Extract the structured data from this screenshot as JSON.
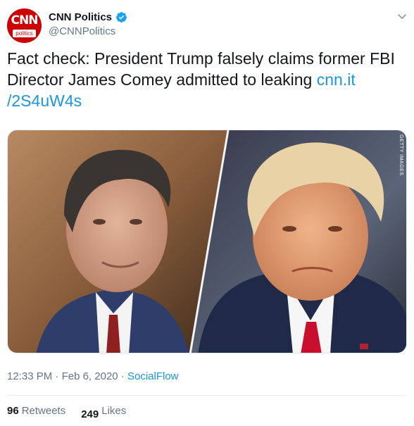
{
  "author": {
    "avatar_text": "CNN",
    "avatar_subtext": "politics",
    "display_name": "CNN Politics",
    "handle": "@CNNPolitics",
    "verified": true
  },
  "tweet": {
    "text": "Fact check: President Trump falsely claims former FBI Director James Comey admitted to leaking ",
    "link_text": "cnn.it /2S4uW4s"
  },
  "media": {
    "credit": "GETTY IMAGES"
  },
  "meta": {
    "time": "12:33 PM",
    "separator": "·",
    "date": "Feb 6, 2020",
    "source": "SocialFlow"
  },
  "stats": {
    "retweets_count": "96",
    "retweets_label": "Retweets",
    "likes_count": "249",
    "likes_label": "Likes"
  },
  "icons": {
    "verified": "verified-badge-icon",
    "caret": "chevron-down-icon"
  },
  "colors": {
    "link": "#1b95e0",
    "brand": "#cc0000",
    "secondary_text": "#657786"
  }
}
